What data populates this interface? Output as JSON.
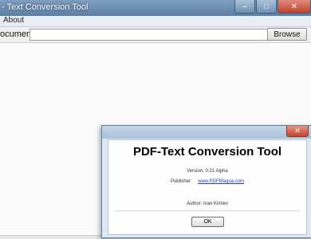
{
  "window": {
    "title": "- Text Conversion Tool",
    "controls": {
      "minimize": "–",
      "maximize": "□",
      "close": "✕"
    }
  },
  "menu": {
    "items": [
      {
        "label": "About"
      }
    ]
  },
  "toolbar": {
    "document_label": "ocument:",
    "document_value": "",
    "browse_label": "Browse"
  },
  "about_dialog": {
    "close_glyph": "✕",
    "title": "PDF-Text Conversion Tool",
    "version_text": "Version: 0.21 Alpha",
    "publisher_label": "Publisher:",
    "publisher_link": "www.PDFMaqua.com",
    "author_text": "Author: Ivan Kimlev",
    "ok_label": "OK"
  }
}
